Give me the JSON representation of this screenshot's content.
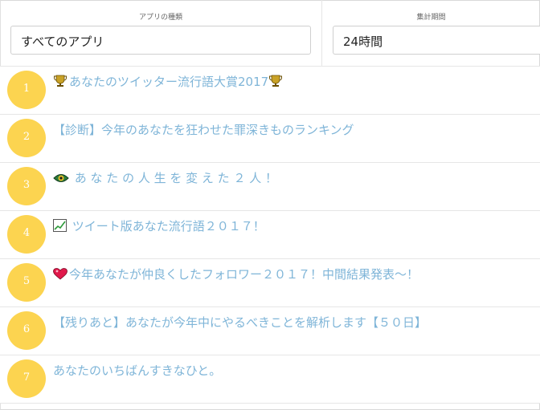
{
  "filters": {
    "app_label": "アプリの種類",
    "app_value": "すべてのアプリ",
    "period_label": "集計期間",
    "period_value": "24時間"
  },
  "rankings": [
    {
      "rank": "1",
      "title": "あなたのツイッター流行語大賞2017",
      "icon": "trophy-icon"
    },
    {
      "rank": "2",
      "title": "【診断】今年のあなたを狂わせた罪深きものランキング",
      "icon": ""
    },
    {
      "rank": "3",
      "title": " あ な た の 人 生 を 変 え た ２ 人 ！",
      "icon": "eye-icon"
    },
    {
      "rank": "4",
      "title": " ツイート版あなた流行語２０１７！",
      "icon": "chart-icon"
    },
    {
      "rank": "5",
      "title": "今年あなたが仲良くしたフォロワー２０１７！中間結果発表～！",
      "icon": "heart-icon"
    },
    {
      "rank": "6",
      "title": "【残りあと】あなたが今年中にやるべきことを解析します【５０日】",
      "icon": ""
    },
    {
      "rank": "7",
      "title": "あなたのいちばんすきなひと。",
      "icon": ""
    }
  ],
  "colors": {
    "rank_circle": "#fcd450",
    "title_link": "#7fb5d8"
  }
}
